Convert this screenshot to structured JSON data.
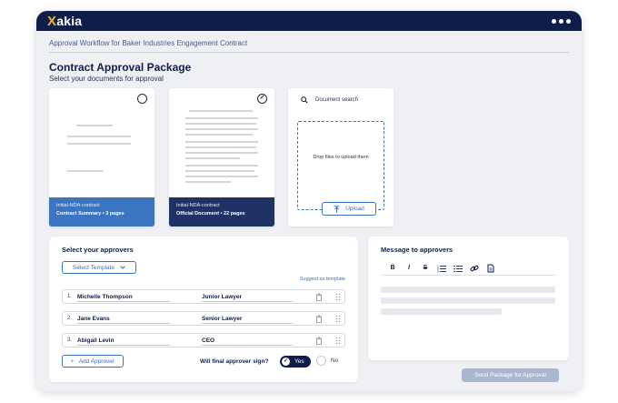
{
  "app": {
    "logo_text": "Xakia",
    "logo_accent": "X",
    "logo_rest": "akia",
    "menu_icon": "more-dots-icon"
  },
  "breadcrumb": "Approval Workflow for Baker Industries Engagement Contract",
  "page": {
    "title": "Contract Approval Package",
    "subtitle": "Select your documents for approval"
  },
  "documents": [
    {
      "filename": "Initial-NDA-contract",
      "meta": "Contract Summary  •  3 pages",
      "selected": false
    },
    {
      "filename": "Initial-NDA-contract",
      "meta": "Official Document  •  22 pages",
      "selected": true
    }
  ],
  "upload": {
    "search_placeholder": "Document search",
    "drop_text": "Drop files to upload them",
    "button_label": "Upload"
  },
  "approvers": {
    "title": "Select your approvers",
    "template_button": "Select Template",
    "suggest_link": "Suggest as template",
    "rows": [
      {
        "num": "1.",
        "name": "Michelle Thompson",
        "role": "Junior Lawyer"
      },
      {
        "num": "2.",
        "name": "Jane Evans",
        "role": "Senior Lawyer"
      },
      {
        "num": "3.",
        "name": "Abigail Levin",
        "role": "CEO"
      }
    ],
    "add_button": "Add Approver",
    "final_sign_question": "Will final approver sign?",
    "yes_label": "Yes",
    "no_label": "No",
    "final_sign_value": "Yes"
  },
  "message": {
    "title": "Message to approvers",
    "toolbar": [
      "B",
      "I",
      "S",
      "ordered-list-icon",
      "bullet-list-icon",
      "link-icon",
      "attachment-icon"
    ]
  },
  "send_button": "Send Package for Approval",
  "colors": {
    "navy": "#0f1d4a",
    "accent_blue": "#3b74c0",
    "brand_gold": "#f0b323",
    "disabled_button": "#aab8cf"
  }
}
